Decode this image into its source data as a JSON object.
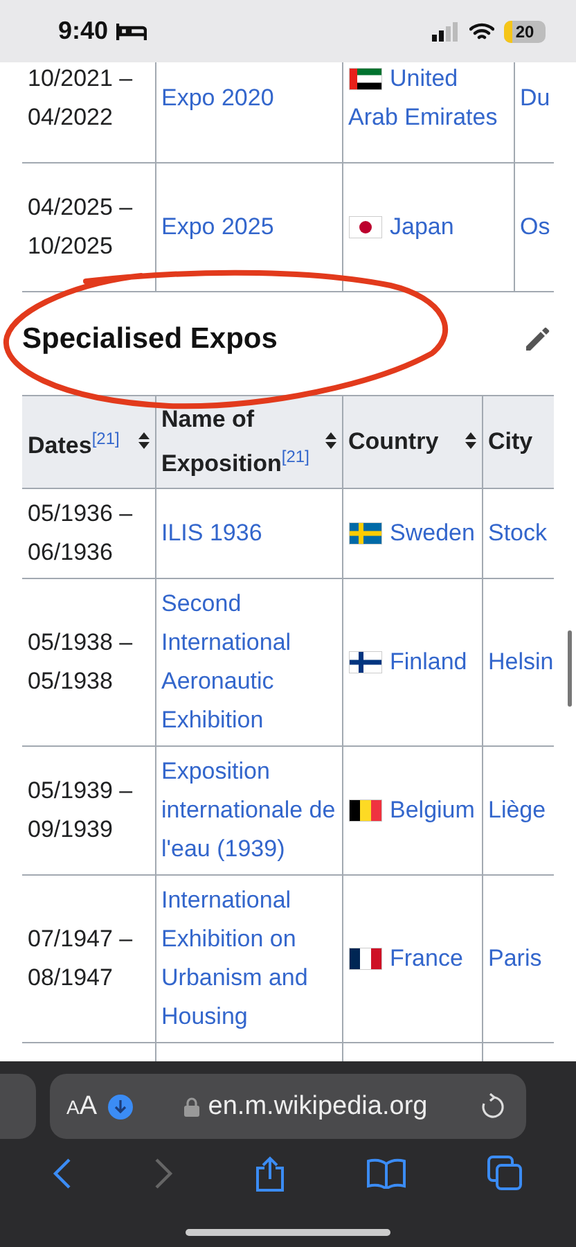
{
  "status_bar": {
    "time": "9:40",
    "battery": "20"
  },
  "top_table": {
    "rows": [
      {
        "dates": "10/2021 – 04/2022",
        "name": "Expo 2020",
        "country": "United Arab Emirates",
        "kind": "uae",
        "city": "Du"
      },
      {
        "dates": "04/2025 – 10/2025",
        "name": "Expo 2025",
        "country": "Japan",
        "kind": "japan",
        "city": "Os"
      }
    ]
  },
  "section": {
    "title": "Specialised Expos"
  },
  "table": {
    "columns": [
      {
        "label": "Dates$^{[21]}$",
        "sortable": true
      },
      {
        "label": "Name of Exposition$^{[21]}$",
        "sortable": true
      },
      {
        "label": "Country",
        "sortable": true
      },
      {
        "label": "City",
        "sortable": false
      }
    ],
    "rows": [
      {
        "dates": "05/1936 – 06/1936",
        "name": "ILIS 1936",
        "country": "Sweden",
        "kind": "sweden",
        "city": "Stock"
      },
      {
        "dates": "05/1938 – 05/1938",
        "name": "Second International Aeronautic Exhibition",
        "country": "Finland",
        "kind": "finland",
        "city": "Helsin"
      },
      {
        "dates": "05/1939 – 09/1939",
        "name": "Exposition internationale de l'eau (1939)",
        "country": "Belgium",
        "kind": "belgium",
        "city": "Liège"
      },
      {
        "dates": "07/1947 – 08/1947",
        "name": "International Exhibition on Urbanism and Housing",
        "country": "France",
        "kind": "france",
        "city": "Paris"
      }
    ]
  },
  "browser": {
    "format_label": "AA",
    "url": "en.m.wikipedia.org",
    "back_enabled": true,
    "forward_enabled": false
  }
}
